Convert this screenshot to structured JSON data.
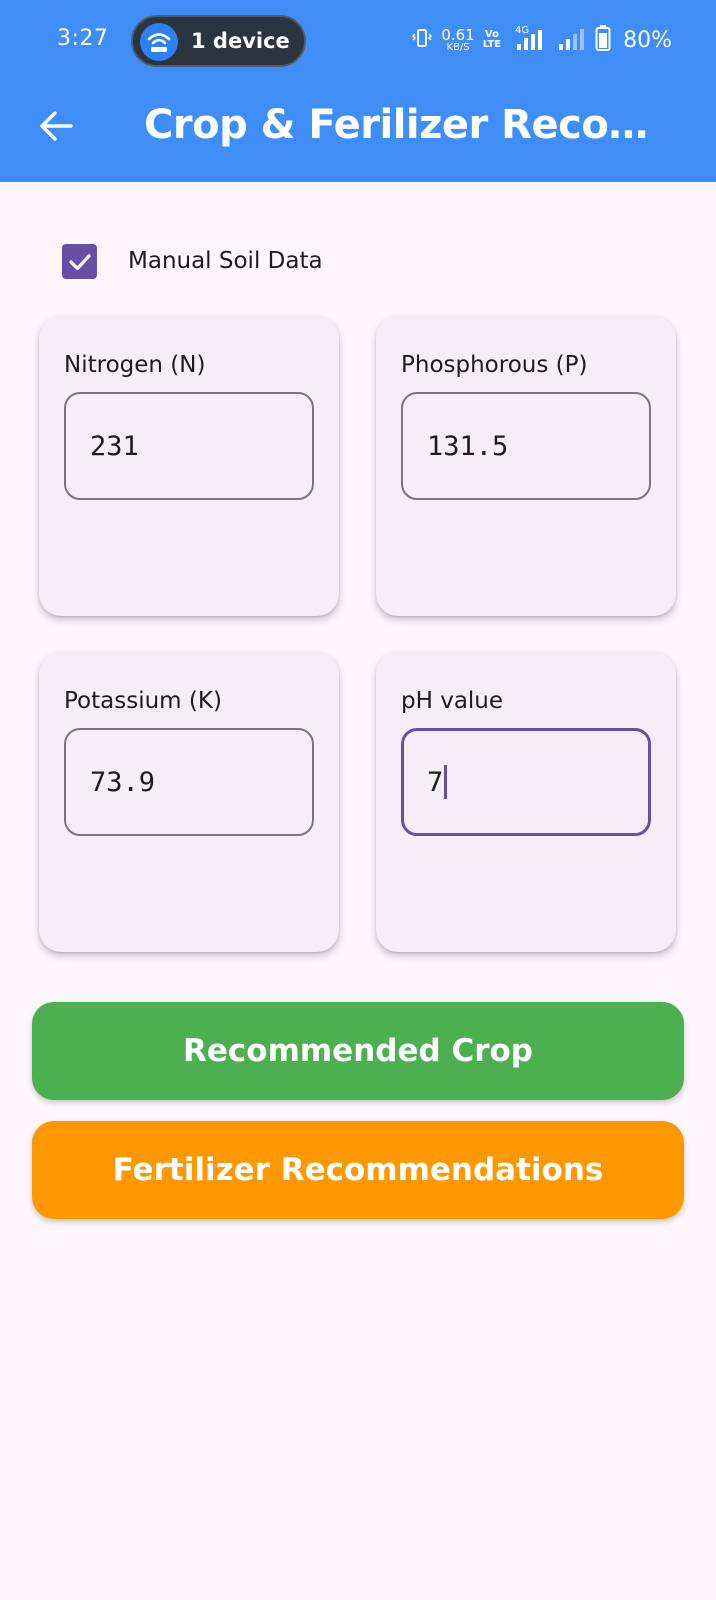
{
  "status_bar": {
    "time": "3:27",
    "device_pill": "1 device",
    "speed_value": "0.61",
    "speed_unit": "KB/S",
    "volte_top": "Vo",
    "volte_bottom": "LTE",
    "network": "4G",
    "battery": "80%"
  },
  "appbar": {
    "title": "Crop & Ferilizer Recomm...",
    "back_icon": "arrow-left-icon",
    "color": "#3f8ef8"
  },
  "manual_soil": {
    "label": "Manual Soil Data",
    "checked": true
  },
  "fields": {
    "nitrogen": {
      "label": "Nitrogen (N)",
      "value": "231"
    },
    "phosphorous": {
      "label": "Phosphorous (P)",
      "value": "131.5"
    },
    "potassium": {
      "label": "Potassium (K)",
      "value": "73.9"
    },
    "ph": {
      "label": "pH value",
      "value": "7",
      "focused": true
    }
  },
  "buttons": {
    "crop": {
      "label": "Recommended Crop",
      "color": "#4caf50"
    },
    "fertilizer": {
      "label": "Fertilizer Recommendations",
      "color": "#ff9800"
    }
  }
}
